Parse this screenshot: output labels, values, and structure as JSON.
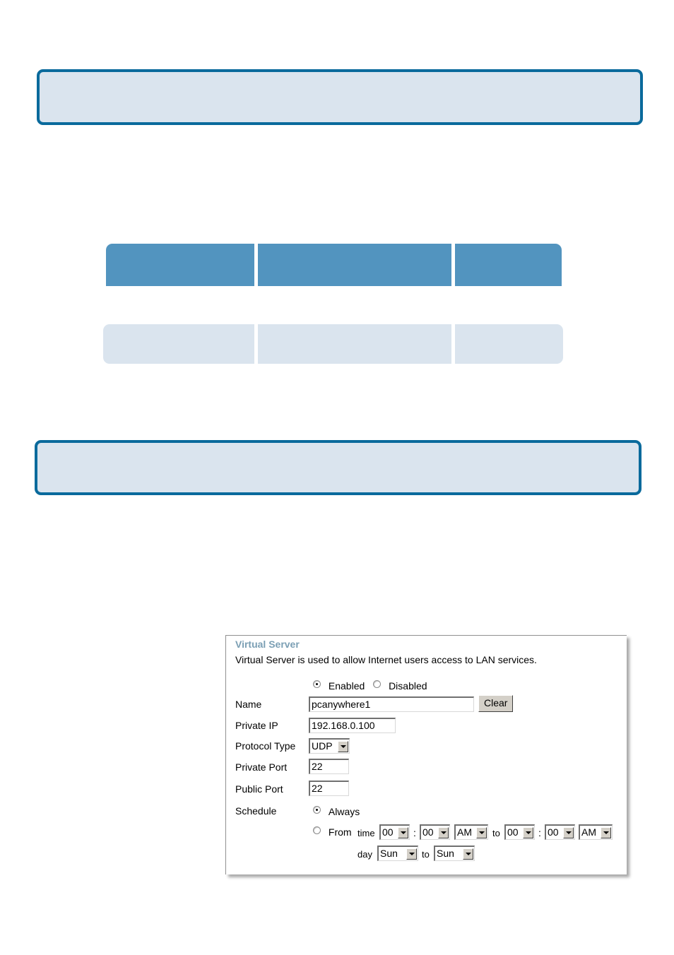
{
  "section_boxes": [
    {
      "id": "box1",
      "text": ""
    },
    {
      "id": "box2",
      "text": ""
    }
  ],
  "table": {
    "headers": [
      "",
      "",
      ""
    ],
    "rows": [
      [
        "",
        "",
        ""
      ]
    ]
  },
  "virtual_server": {
    "title": "Virtual Server",
    "description": "Virtual Server is used to allow Internet users access to LAN services.",
    "status": {
      "enabled_label": "Enabled",
      "disabled_label": "Disabled",
      "selected": "Enabled"
    },
    "name": {
      "label": "Name",
      "value": "pcanywhere1",
      "clear_label": "Clear"
    },
    "private_ip": {
      "label": "Private IP",
      "value": "192.168.0.100"
    },
    "protocol_type": {
      "label": "Protocol Type",
      "value": "UDP"
    },
    "private_port": {
      "label": "Private Port",
      "value": "22"
    },
    "public_port": {
      "label": "Public Port",
      "value": "22"
    },
    "schedule": {
      "label": "Schedule",
      "always_label": "Always",
      "from_label": "From",
      "selected": "Always",
      "time_label": "time",
      "colon": ":",
      "to_label": "to",
      "day_label": "day",
      "start_hour": "00",
      "start_minute": "00",
      "start_ampm": "AM",
      "end_hour": "00",
      "end_minute": "00",
      "end_ampm": "AM",
      "start_day": "Sun",
      "end_day": "Sun"
    }
  }
}
